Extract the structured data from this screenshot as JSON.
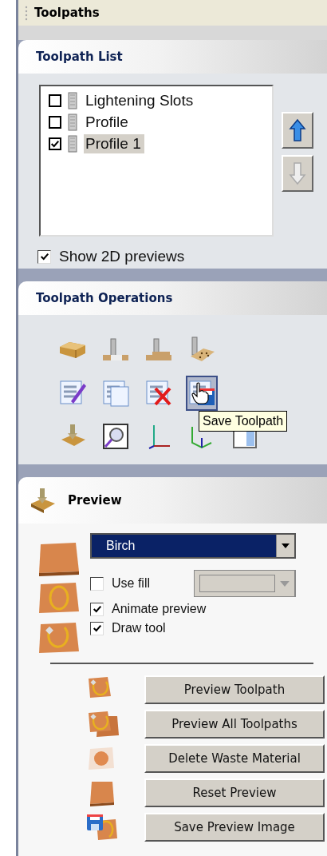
{
  "title": "Toolpaths",
  "toolpath_list": {
    "title": "Toolpath List",
    "items": [
      {
        "label": "Lightening Slots",
        "checked": false,
        "selected": false
      },
      {
        "label": "Profile",
        "checked": false,
        "selected": false
      },
      {
        "label": "Profile 1",
        "checked": true,
        "selected": true
      }
    ],
    "move_up": {
      "disabled": false
    },
    "move_down": {
      "disabled": true
    },
    "show_2d_previews": {
      "label": "Show 2D previews",
      "checked": true
    }
  },
  "operations": {
    "title": "Toolpath Operations",
    "rows": [
      [
        {
          "kind": "block",
          "selected": false
        },
        {
          "kind": "slot",
          "selected": false
        },
        {
          "kind": "pocket",
          "selected": false
        },
        {
          "kind": "drill",
          "selected": false
        }
      ],
      [
        {
          "kind": "gcode-edit",
          "selected": false
        },
        {
          "kind": "gcode-copy",
          "selected": false
        },
        {
          "kind": "gcode-delete",
          "selected": false
        },
        {
          "kind": "gcode-save",
          "selected": true
        }
      ],
      [
        {
          "kind": "preview",
          "selected": false
        },
        {
          "kind": "zoom",
          "selected": false
        },
        {
          "kind": "axes",
          "selected": false
        },
        {
          "kind": "axes3d",
          "selected": false
        },
        {
          "kind": "window",
          "selected": false
        }
      ]
    ],
    "tooltip": "Save Toolpath"
  },
  "preview": {
    "title": "Preview",
    "material": "Birch",
    "use_fill": {
      "label": "Use fill",
      "checked": false
    },
    "animate_preview": {
      "label": "Animate preview",
      "checked": true
    },
    "draw_tool": {
      "label": "Draw tool",
      "checked": true
    },
    "buttons": [
      {
        "kind": "tool",
        "label": "Preview Toolpath"
      },
      {
        "kind": "tools",
        "label": "Preview All Toolpaths"
      },
      {
        "kind": "waste",
        "label": "Delete Waste Material"
      },
      {
        "kind": "board",
        "label": "Reset Preview"
      },
      {
        "kind": "save",
        "label": "Save Preview Image"
      }
    ]
  }
}
